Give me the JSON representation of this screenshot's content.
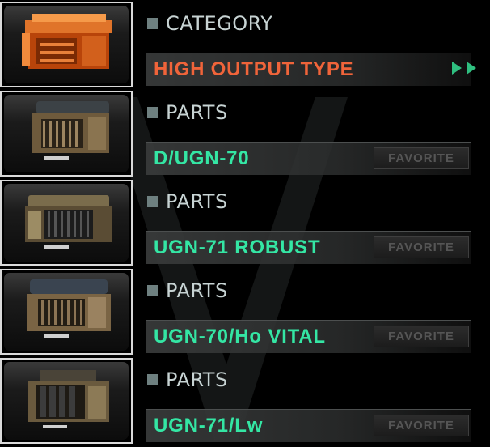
{
  "category": {
    "header": "CATEGORY",
    "value": "HIGH OUTPUT TYPE",
    "thumbnail_icon": "orange-generator-icon"
  },
  "parts": [
    {
      "header": "PARTS",
      "name": "D/UGN-70",
      "favorite_label": "FAVORITE",
      "thumbnail_icon": "generator-unit-icon"
    },
    {
      "header": "PARTS",
      "name": "UGN-71 ROBUST",
      "favorite_label": "FAVORITE",
      "thumbnail_icon": "generator-unit-icon"
    },
    {
      "header": "PARTS",
      "name": "UGN-70/Ho VITAL",
      "favorite_label": "FAVORITE",
      "thumbnail_icon": "generator-unit-icon"
    },
    {
      "header": "PARTS",
      "name": "UGN-71/Lw",
      "favorite_label": "FAVORITE",
      "thumbnail_icon": "generator-unit-icon"
    }
  ],
  "colors": {
    "category_value": "#f0643a",
    "part_name": "#34e6a4",
    "header_text": "#c7d3d3",
    "arrows": "#2fbf80"
  }
}
